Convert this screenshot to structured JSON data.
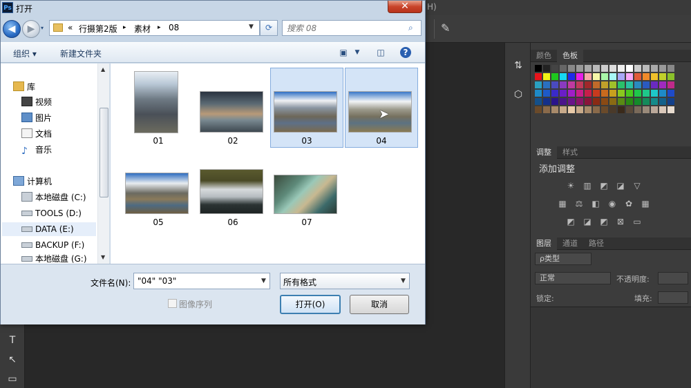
{
  "photoshop": {
    "menu_fragment": "H)",
    "swatch_tabs": [
      "颜色",
      "色板"
    ],
    "adjust_tabs": [
      "调整",
      "样式"
    ],
    "adjust_title": "添加调整",
    "layer_tabs": [
      "图层",
      "通道",
      "路径"
    ],
    "layer_filter": "ρ类型",
    "blend_mode": "正常",
    "opacity_label": "不透明度:",
    "lock_label": "锁定:",
    "fill_label": "填充:",
    "colors": {
      "panel_bg": "#3c3c3c",
      "canvas_bg": "#282828"
    }
  },
  "dialog": {
    "title": "打开",
    "app_icon": "Ps",
    "close_glyph": "✕",
    "address": {
      "prefix": "«",
      "crumbs": [
        "行摄第2版",
        "素材",
        "08"
      ],
      "separator": "▸"
    },
    "search_placeholder": "搜索 08",
    "toolbar": {
      "organize": "组织 ▾",
      "new_folder": "新建文件夹"
    },
    "nav": {
      "items": [
        {
          "label": "库",
          "icon": "library-icon"
        },
        {
          "label": "视频",
          "icon": "video-icon"
        },
        {
          "label": "图片",
          "icon": "pictures-icon"
        },
        {
          "label": "文档",
          "icon": "documents-icon"
        },
        {
          "label": "音乐",
          "icon": "music-icon"
        },
        {
          "label": "计算机",
          "icon": "computer-icon"
        },
        {
          "label": "本地磁盘 (C:)",
          "icon": "drive-icon"
        },
        {
          "label": "TOOLS (D:)",
          "icon": "drive-icon"
        },
        {
          "label": "DATA (E:)",
          "icon": "drive-icon",
          "selected": true
        },
        {
          "label": "BACKUP (F:)",
          "icon": "drive-icon"
        },
        {
          "label": "本地磁盘 (G:)",
          "icon": "drive-icon"
        }
      ]
    },
    "files": [
      {
        "name": "01",
        "selected": false
      },
      {
        "name": "02",
        "selected": false
      },
      {
        "name": "03",
        "selected": true
      },
      {
        "name": "04",
        "selected": true
      },
      {
        "name": "05",
        "selected": false
      },
      {
        "name": "06",
        "selected": false
      },
      {
        "name": "07",
        "selected": false
      }
    ],
    "filename_label": "文件名(N):",
    "filename_value": "\"04\" \"03\"",
    "format_value": "所有格式",
    "sequence_label": "图像序列",
    "open_label": "打开(O)",
    "cancel_label": "取消"
  }
}
